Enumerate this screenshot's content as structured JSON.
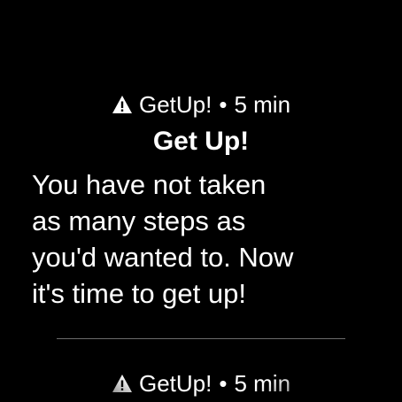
{
  "notification": {
    "app_name": "GetUp!",
    "separator": "•",
    "time": "5 min",
    "icon": "warning-icon",
    "title": "Get Up!",
    "body": "You have not taken\nas many steps as\nyou'd wanted to. Now\nit's time to get up!"
  },
  "next_notification": {
    "app_name": "GetUp!",
    "separator": "•",
    "time": "5 min",
    "icon": "warning-icon"
  },
  "colors": {
    "background": "#000000",
    "text": "#ffffff",
    "divider": "#6b6b6b"
  }
}
